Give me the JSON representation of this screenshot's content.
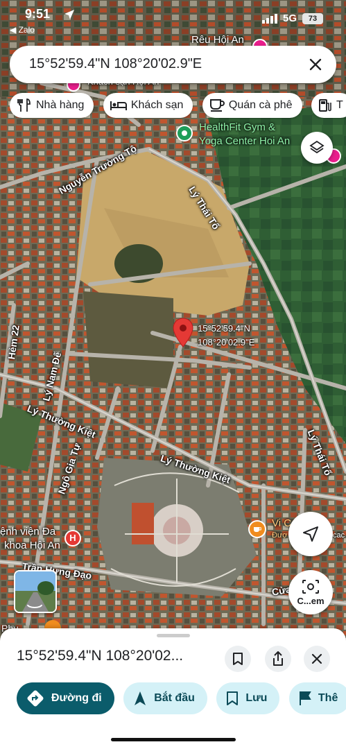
{
  "status_bar": {
    "time": "9:51",
    "back_app": "◀ Zalo",
    "network": "5G",
    "battery": "73"
  },
  "search": {
    "query": "15°52'59.4\"N 108°20'02.9\"E"
  },
  "chips": [
    {
      "icon": "restaurant-icon",
      "label": "Nhà hàng"
    },
    {
      "icon": "hotel-icon",
      "label": "Khách sạn"
    },
    {
      "icon": "coffee-icon",
      "label": "Quán cà phê"
    },
    {
      "icon": "gas-station-icon",
      "label": "T"
    }
  ],
  "map": {
    "pin_label": {
      "line1": "15°52'59.4\"N",
      "line2": "108°20'02.9\"E"
    },
    "streets": {
      "nguyen_truong_to": "Nguyễn Trường Tộ",
      "ly_thai_to_1": "Lý Thái Tổ",
      "ly_thai_to_2": "Lý Thái Tổ",
      "hem_22": "Hẻm 22",
      "ly_nam_de": "Lý Nam Đế",
      "ly_thuong_kiet_1": "Lý Thường Kiệt",
      "ly_thuong_kiet_2": "Lý Thường Kiệt",
      "ngo_gia_tu": "Ngô Gia Tự",
      "tran_hung_dao": "Trần Hưng Đạo",
      "cua": "Cửa"
    },
    "pois": {
      "reu_hoi_an": "Rêu Hội An",
      "khach_san": "Khách sạn Hội An",
      "healthfit_1": "HealthFit Gym &",
      "healthfit_2": "Yoga Center Hoi An",
      "benh_vien_1": "ệnh viện Đa",
      "benh_vien_2": "khoa Hội An",
      "vi": "Vi C",
      "duoc": "Đượ",
      "cac": "cac",
      "phu": "Phu"
    }
  },
  "controls": {
    "streetview_label": "C...em"
  },
  "sheet": {
    "title": "15°52'59.4\"N 108°20'02...",
    "actions": [
      {
        "icon": "directions-icon",
        "label": "Đường đi",
        "style": "primary"
      },
      {
        "icon": "navigation-icon",
        "label": "Bắt đầu",
        "style": "secondary"
      },
      {
        "icon": "bookmark-icon",
        "label": "Lưu",
        "style": "secondary"
      },
      {
        "icon": "flag-icon",
        "label": "Thê",
        "style": "secondary"
      }
    ]
  },
  "colors": {
    "primary": "#0b5c6b",
    "secondary_bg": "#d4f1f7",
    "pin": "#e53935"
  }
}
